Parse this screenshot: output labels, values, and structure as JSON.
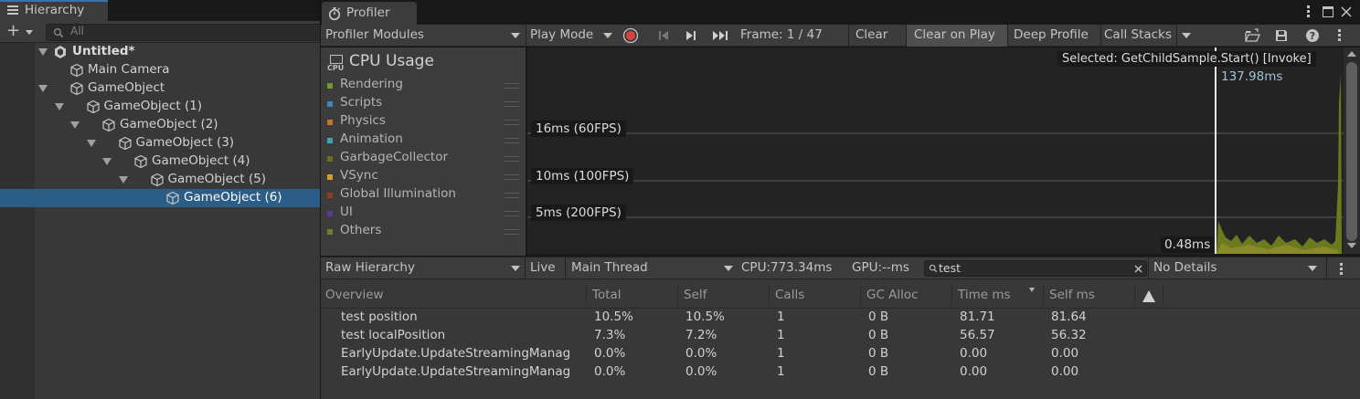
{
  "hierarchy": {
    "tab_label": "Hierarchy",
    "search_placeholder": "All",
    "scene_name": "Untitled*",
    "items": [
      {
        "label": "Main Camera"
      },
      {
        "label": "GameObject"
      },
      {
        "label": "GameObject (1)"
      },
      {
        "label": "GameObject (2)"
      },
      {
        "label": "GameObject (3)"
      },
      {
        "label": "GameObject (4)"
      },
      {
        "label": "GameObject (5)"
      },
      {
        "label": "GameObject (6)",
        "selected": true
      }
    ]
  },
  "profiler": {
    "tab_label": "Profiler",
    "toolbar": {
      "modules_label": "Profiler Modules",
      "play_mode_label": "Play Mode",
      "frame_label": "Frame: 1 / 47",
      "clear_label": "Clear",
      "clear_on_play_label": "Clear on Play",
      "deep_profile_label": "Deep Profile",
      "call_stacks_label": "Call Stacks"
    },
    "module": {
      "icon_text": "CPU",
      "title": "CPU Usage",
      "categories": [
        {
          "name": "Rendering",
          "color": "#6e9b2c"
        },
        {
          "name": "Scripts",
          "color": "#3b87c2"
        },
        {
          "name": "Physics",
          "color": "#c5722b"
        },
        {
          "name": "Animation",
          "color": "#3ea1b6"
        },
        {
          "name": "GarbageCollector",
          "color": "#6d6e1f"
        },
        {
          "name": "VSync",
          "color": "#c8a22a"
        },
        {
          "name": "Global Illumination",
          "color": "#8e3f28"
        },
        {
          "name": "UI",
          "color": "#5c3a9c"
        },
        {
          "name": "Others",
          "color": "#6a7f26"
        }
      ]
    },
    "chart": {
      "selected_label": "Selected: GetChildSample.Start() [Invoke]",
      "selected_value": "137.98ms",
      "min_value_label": "0.48ms",
      "fps_lines": [
        {
          "label": "16ms (60FPS)"
        },
        {
          "label": "10ms (100FPS)"
        },
        {
          "label": "5ms (200FPS)"
        }
      ]
    },
    "details_toolbar": {
      "view_label": "Raw Hierarchy",
      "live_label": "Live",
      "thread_label": "Main Thread",
      "cpu_label": "CPU:773.34ms",
      "gpu_label": "GPU:--ms",
      "search_value": "test",
      "details_label": "No Details"
    },
    "table": {
      "columns": [
        "Overview",
        "Total",
        "Self",
        "Calls",
        "GC Alloc",
        "Time ms",
        "Self ms"
      ],
      "rows": [
        {
          "name": "test position",
          "total": "10.5%",
          "self": "10.5%",
          "calls": "1",
          "gc": "0 B",
          "time": "81.71",
          "self_ms": "81.64"
        },
        {
          "name": "test localPosition",
          "total": "7.3%",
          "self": "7.2%",
          "calls": "1",
          "gc": "0 B",
          "time": "56.57",
          "self_ms": "56.32"
        },
        {
          "name": "EarlyUpdate.UpdateStreamingManag",
          "total": "0.0%",
          "self": "0.0%",
          "calls": "1",
          "gc": "0 B",
          "time": "0.00",
          "self_ms": "0.00"
        },
        {
          "name": "EarlyUpdate.UpdateStreamingManag",
          "total": "0.0%",
          "self": "0.0%",
          "calls": "1",
          "gc": "0 B",
          "time": "0.00",
          "self_ms": "0.00"
        }
      ]
    }
  }
}
